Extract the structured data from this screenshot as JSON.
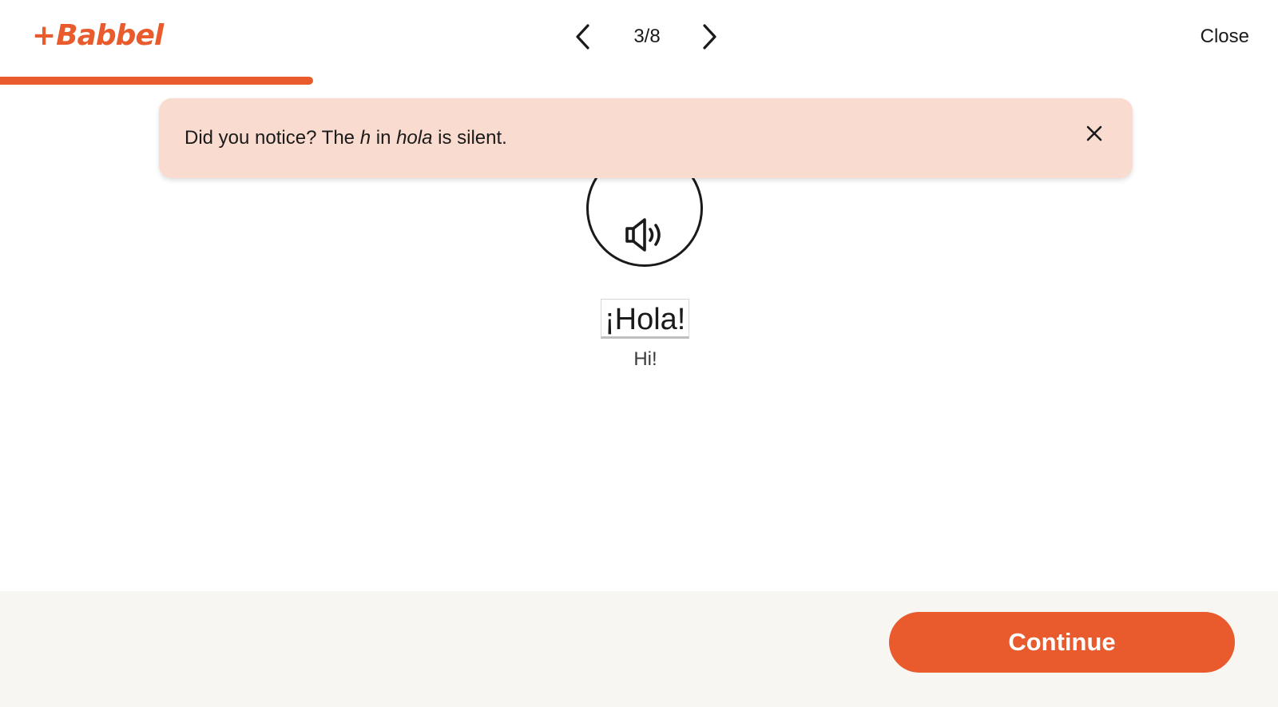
{
  "header": {
    "logo_plus": "+",
    "logo_text": "Babbel",
    "counter": "3/8",
    "close_label": "Close"
  },
  "progress": {
    "current": 3,
    "total": 8,
    "fraction": 0.245
  },
  "tip": {
    "text_before": "Did you notice? The ",
    "emph_letter": "h",
    "text_middle": " in ",
    "emph_word": "hola",
    "text_after": " is silent."
  },
  "vocab": {
    "word": "¡Hola!",
    "translation": "Hi!"
  },
  "footer": {
    "continue_label": "Continue"
  },
  "icons": {
    "prev": "chevron-left-icon",
    "next": "chevron-right-icon",
    "close": "close-icon",
    "audio": "speaker-icon"
  },
  "colors": {
    "brand": "#e95a2c",
    "tip_bg": "#f9dbd0",
    "footer_bg": "#f7f6f3"
  }
}
